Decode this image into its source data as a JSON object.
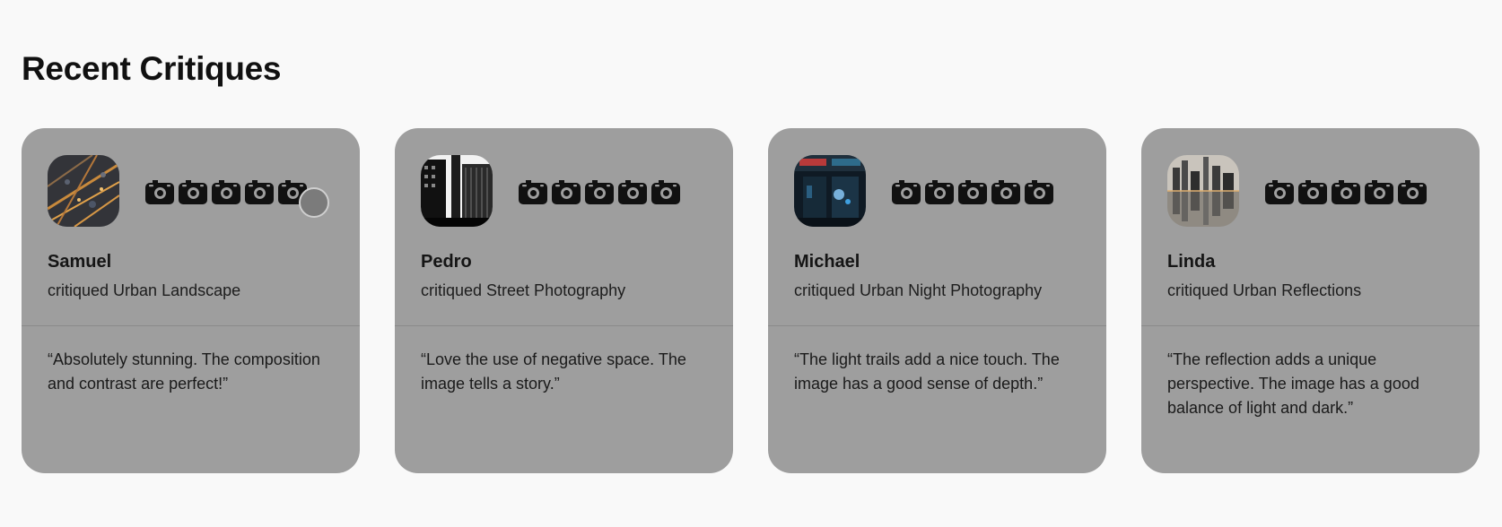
{
  "section": {
    "title": "Recent Critiques"
  },
  "colors": {
    "card_bg": "#9e9e9e",
    "page_bg": "#f9f9f9",
    "icon": "#111111"
  },
  "rating_icon": "camera-icon",
  "critiques": [
    {
      "name": "Samuel",
      "action": "critiqued Urban Landscape",
      "quote": "“Absolutely stunning. The composition and contrast are perfect!”",
      "rating": 5,
      "avatar": "aerial-city-night-thumbnail"
    },
    {
      "name": "Pedro",
      "action": "critiqued Street Photography",
      "quote": "“Love the use of negative space. The image tells a story.”",
      "rating": 5,
      "avatar": "black-white-buildings-thumbnail"
    },
    {
      "name": "Michael",
      "action": "critiqued Urban Night Photography",
      "quote": "“The light trails add a nice touch. The image has a good sense of depth.”",
      "rating": 5,
      "avatar": "neon-window-thumbnail"
    },
    {
      "name": "Linda",
      "action": "critiqued Urban Reflections",
      "quote": "“The reflection adds a unique perspective. The image has a good balance of light and dark.”",
      "rating": 5,
      "avatar": "skyline-reflection-thumbnail"
    }
  ]
}
